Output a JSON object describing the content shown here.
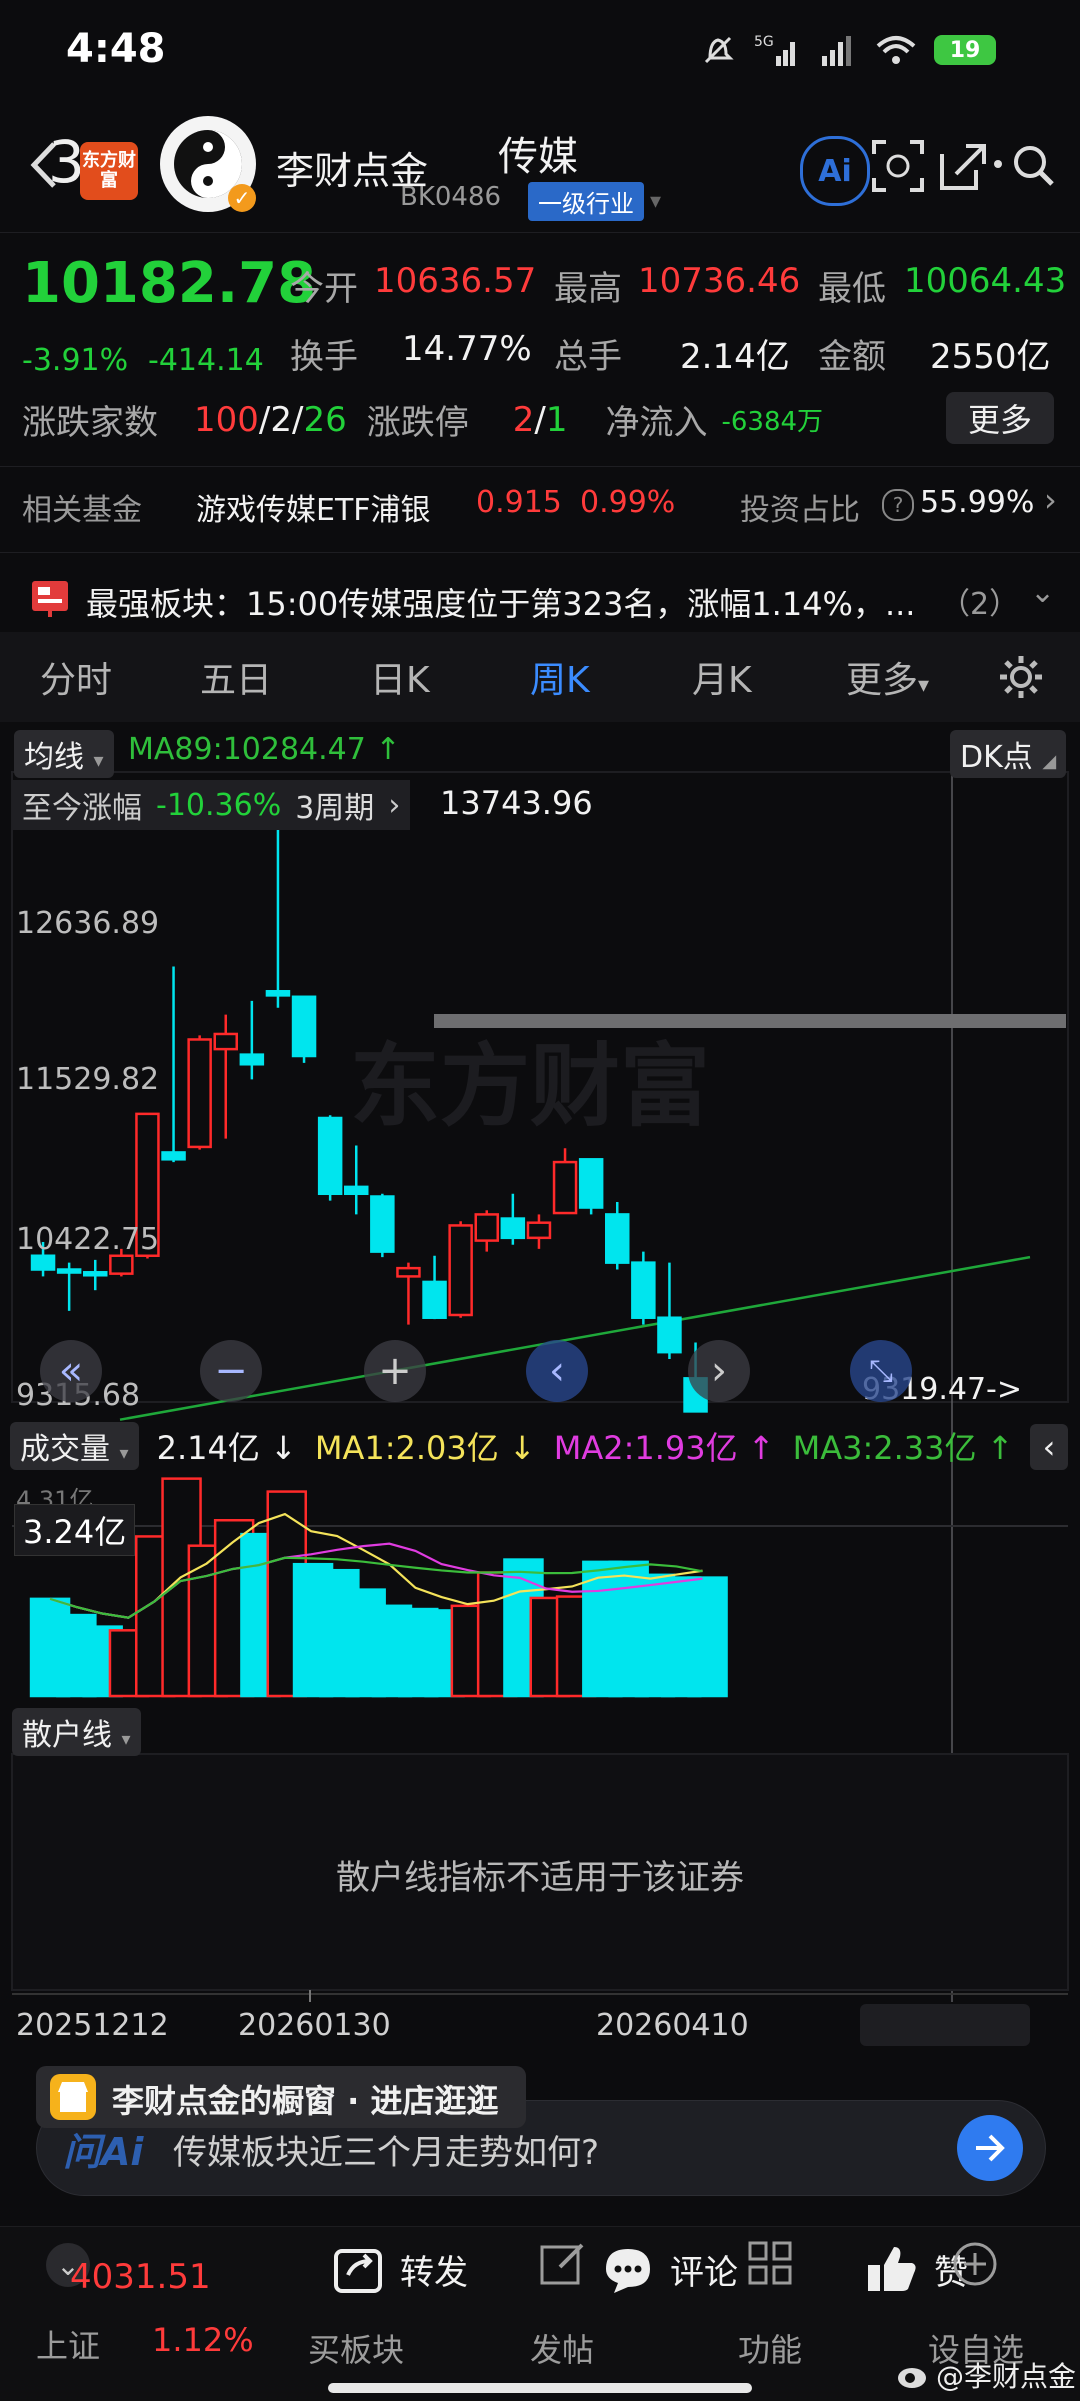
{
  "status": {
    "time": "4:48",
    "battery": "19"
  },
  "header": {
    "back_count": "3",
    "mini_logo_text": "东方财富",
    "author": "李财点金",
    "title": "传媒",
    "code": "BK0486",
    "category": "一级行业",
    "ai_label": "Ai"
  },
  "quote": {
    "price": "10182.78",
    "change_pct": "-3.91%",
    "change_amt": "-414.14",
    "open_label": "今开",
    "open": "10636.57",
    "high_label": "最高",
    "high": "10736.46",
    "low_label": "最低",
    "low": "10064.43",
    "turnover_label": "换手",
    "turnover": "14.77%",
    "volume_label": "总手",
    "volume": "2.14亿",
    "amount_label": "金额",
    "amount": "2550亿",
    "breadth_label": "涨跌家数",
    "up": "100",
    "sep1": "/",
    "flat": "2",
    "sep2": "/",
    "down": "26",
    "limit_label": "涨跌停",
    "limit_up": "2",
    "sep3": "/",
    "limit_down": "1",
    "netflow_label": "净流入",
    "netflow": "-6384万",
    "more": "更多"
  },
  "fund": {
    "label": "相关基金",
    "name": "游戏传媒ETF浦银",
    "price": "0.915",
    "pct": "0.99%",
    "ratio_label": "投资占比",
    "ratio": "55.99%"
  },
  "news": {
    "text": "最强板块：15:00传媒强度位于第323名，涨幅1.14%，...",
    "count": "（2）"
  },
  "tabs": [
    "分时",
    "五日",
    "日K",
    "周K",
    "月K",
    "更多"
  ],
  "chart": {
    "ma_toggle": "均线",
    "ma89": "MA89:10284.47 ↑",
    "dk": "DK点",
    "since_label": "至今涨幅",
    "since_value": "-10.36%",
    "since_period": "3周期",
    "peak_label": "13743.96",
    "axis_ticks": [
      "12636.89",
      "11529.82",
      "10422.75",
      "9315.68"
    ],
    "low_marker": "9319.47->",
    "vol_label": "成交量",
    "vol_value": "2.14亿 ↓",
    "ma1": "MA1:2.03亿 ↓",
    "ma2": "MA2:1.93亿 ↑",
    "ma3": "MA3:2.33亿 ↑",
    "vol_axis_top": "4.31亿",
    "vol_axis_mid": "3.24亿",
    "retail_label": "散户线",
    "retail_msg": "散户线指标不适用于该证券",
    "date_labels": [
      "20251212",
      "20260130",
      "20260410"
    ],
    "colors": {
      "up": "#ff2a2a",
      "down": "#00e5ee",
      "ma89": "#1fa83a",
      "ma1": "#f4e35a",
      "ma2": "#e03ce0",
      "ma3": "#3bbd3b"
    }
  },
  "chart_data": {
    "type": "candlestick",
    "candles": [
      {
        "o": 10450,
        "c": 10350,
        "h": 10550,
        "l": 10300
      },
      {
        "o": 10350,
        "c": 10330,
        "h": 10400,
        "l": 10050
      },
      {
        "o": 10330,
        "c": 10310,
        "h": 10420,
        "l": 10200
      },
      {
        "o": 10320,
        "c": 10450,
        "h": 10500,
        "l": 10300
      },
      {
        "o": 10450,
        "c": 11480,
        "h": 11480,
        "l": 10430
      },
      {
        "o": 11200,
        "c": 11150,
        "h": 12550,
        "l": 11130
      },
      {
        "o": 11240,
        "c": 12020,
        "h": 12050,
        "l": 11220
      },
      {
        "o": 11950,
        "c": 12060,
        "h": 12200,
        "l": 11300
      },
      {
        "o": 11910,
        "c": 11840,
        "h": 12300,
        "l": 11730
      },
      {
        "o": 12370,
        "c": 12340,
        "h": 13743.96,
        "l": 12250
      },
      {
        "o": 12330,
        "c": 11900,
        "h": 12330,
        "l": 11850
      },
      {
        "o": 11450,
        "c": 10900,
        "h": 11470,
        "l": 10850
      },
      {
        "o": 10950,
        "c": 10900,
        "h": 11250,
        "l": 10750
      },
      {
        "o": 10880,
        "c": 10480,
        "h": 10900,
        "l": 10440
      },
      {
        "o": 10300,
        "c": 10360,
        "h": 10400,
        "l": 9950
      },
      {
        "o": 10260,
        "c": 10000,
        "h": 10450,
        "l": 9990
      },
      {
        "o": 10020,
        "c": 10670,
        "h": 10700,
        "l": 10000
      },
      {
        "o": 10560,
        "c": 10750,
        "h": 10780,
        "l": 10480
      },
      {
        "o": 10720,
        "c": 10580,
        "h": 10900,
        "l": 10530
      },
      {
        "o": 10580,
        "c": 10690,
        "h": 10750,
        "l": 10500
      },
      {
        "o": 10760,
        "c": 11130,
        "h": 11230,
        "l": 10760
      },
      {
        "o": 11150,
        "c": 10800,
        "h": 11150,
        "l": 10750
      },
      {
        "o": 10750,
        "c": 10400,
        "h": 10840,
        "l": 10350
      },
      {
        "o": 10400,
        "c": 10000,
        "h": 10480,
        "l": 9950
      },
      {
        "o": 10000,
        "c": 9750,
        "h": 10400,
        "l": 9700
      },
      {
        "o": 9560,
        "c": 9320,
        "h": 9820,
        "l": 9319.47
      }
    ],
    "ma89": [
      9260,
      10440
    ],
    "volumes": [
      {
        "v": 2.1,
        "up": false
      },
      {
        "v": 1.75,
        "up": false
      },
      {
        "v": 1.5,
        "up": false
      },
      {
        "v": 1.42,
        "up": true
      },
      {
        "v": 3.45,
        "up": true
      },
      {
        "v": 4.7,
        "up": true
      },
      {
        "v": 3.25,
        "up": true
      },
      {
        "v": 3.8,
        "up": true
      },
      {
        "v": 3.5,
        "up": false
      },
      {
        "v": 4.42,
        "up": true
      },
      {
        "v": 2.85,
        "up": false
      },
      {
        "v": 2.72,
        "up": false
      },
      {
        "v": 2.3,
        "up": false
      },
      {
        "v": 1.95,
        "up": false
      },
      {
        "v": 1.88,
        "up": false
      },
      {
        "v": 1.85,
        "up": false
      },
      {
        "v": 1.95,
        "up": true
      },
      {
        "v": 2.67,
        "up": true
      },
      {
        "v": 2.95,
        "up": false
      },
      {
        "v": 2.12,
        "up": true
      },
      {
        "v": 2.15,
        "up": true
      },
      {
        "v": 2.9,
        "up": false
      },
      {
        "v": 2.9,
        "up": false
      },
      {
        "v": 2.62,
        "up": false
      },
      {
        "v": 2.56,
        "up": false
      },
      {
        "v": 2.56,
        "up": false
      }
    ],
    "ylim": [
      9315.68,
      13743.96
    ],
    "vol_max": 4.8
  },
  "bottom": {
    "promo": "李财点金的橱窗 · 进店逛逛",
    "ask_logo": "问Ai",
    "ask_text": "传媒板块近三个月走势如何?",
    "index_name": "上证",
    "index_value": "4031.51",
    "index_pct": "1.12%",
    "items": [
      "买板块",
      "发帖",
      "功能",
      "设自选"
    ],
    "share": "转发",
    "comment": "评论",
    "like": "赞",
    "watermark": "@李财点金"
  }
}
